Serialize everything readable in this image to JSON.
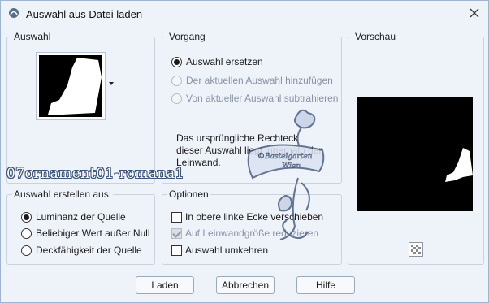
{
  "window": {
    "title": "Auswahl aus Datei laden",
    "icon": "app-icon",
    "close_icon": "close-icon"
  },
  "selection_group": {
    "title": "Auswahl",
    "dropdown_icon": "chevron-down-icon"
  },
  "process_group": {
    "title": "Vorgang",
    "options": [
      {
        "label": "Auswahl ersetzen",
        "checked": true,
        "enabled": true
      },
      {
        "label": "Der aktuellen Auswahl hinzufügen",
        "checked": false,
        "enabled": false
      },
      {
        "label": "Von aktueller Auswahl subtrahieren",
        "checked": false,
        "enabled": false
      }
    ],
    "description": "Das ursprüngliche Rechteck dieser Auswahl liegt innerhalb der Leinwand."
  },
  "preview_group": {
    "title": "Vorschau",
    "background_toggle_icon": "checkerboard-icon"
  },
  "create_from_group": {
    "title": "Auswahl erstellen aus:",
    "options": [
      {
        "label": "Luminanz der Quelle",
        "checked": true
      },
      {
        "label": "Beliebiger Wert außer Null",
        "checked": false
      },
      {
        "label": "Deckfähigkeit der Quelle",
        "checked": false
      }
    ]
  },
  "options_group": {
    "title": "Optionen",
    "items": [
      {
        "label": "In obere linke Ecke verschieben",
        "checked": false,
        "enabled": true
      },
      {
        "label": "Auf Leinwandgröße reduzieren",
        "checked": true,
        "enabled": false
      },
      {
        "label": "Auswahl umkehren",
        "checked": false,
        "enabled": true
      }
    ]
  },
  "buttons": {
    "load": "Laden",
    "cancel": "Abbrechen",
    "help": "Hilfe"
  },
  "overlay": {
    "file_label": "07ornament01-romana1",
    "watermark": "©Bastelgarten Wien"
  },
  "colors": {
    "window_bg": "#eef2f9",
    "group_border": "#c9d2de",
    "disabled_text": "#8a94a6",
    "preview_bg": "#000000"
  }
}
